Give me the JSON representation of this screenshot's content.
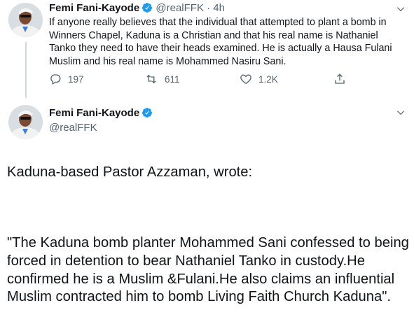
{
  "tweet": {
    "author_name": "Femi Fani-Kayode",
    "handle": "@realFFK",
    "separator": "·",
    "time": "4h",
    "text": "If anyone really believes that the individual that attempted to plant a bomb in Winners Chapel, Kaduna is a Christian and that his real name is Nathaniel Tanko they need to have their heads examined. He is actually a Hausa Fulani Muslim and his real name is Mohammed Nasiru Sani.",
    "reply_count": "197",
    "retweet_count": "611",
    "like_count": "1.2K"
  },
  "reply": {
    "author_name": "Femi Fani-Kayode",
    "handle": "@realFFK",
    "paragraph1": "Kaduna-based Pastor Azzaman, wrote:",
    "paragraph2": "\"The Kaduna bomb planter Mohammed Sani confessed to being forced in detention to bear Nathaniel Tanko in custody.He confirmed he is a Muslim &Fulani.He also claims an influential Muslim contracted him to bomb Living Faith Church Kaduna\"."
  },
  "colors": {
    "verified": "#1d9bf0",
    "text": "#0f1419",
    "muted": "#536471",
    "thread_line": "#cfd9de"
  },
  "icons": [
    "verified-badge-icon",
    "chevron-down-icon",
    "reply-icon",
    "retweet-icon",
    "like-icon",
    "share-icon"
  ]
}
